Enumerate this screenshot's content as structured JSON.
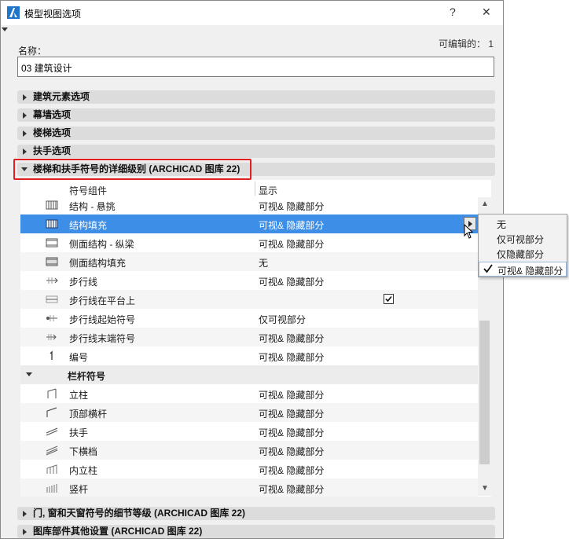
{
  "window": {
    "title": "模型视图选项",
    "help": "?",
    "close": "✕"
  },
  "form": {
    "name_label": "名称：",
    "editable_label": "可编辑的： 1",
    "name_value": "03 建筑设计"
  },
  "sections_top": [
    {
      "label": "建筑元素选项"
    },
    {
      "label": "幕墙选项"
    },
    {
      "label": "楼梯选项"
    },
    {
      "label": "扶手选项"
    },
    {
      "label": "楼梯和扶手符号的详细级别 (ARCHICAD 图库 22)"
    }
  ],
  "table": {
    "col_component": "符号组件",
    "col_display": "显示",
    "rows": [
      {
        "name": "结构 - 悬挑",
        "value": "可视& 隐藏部分",
        "icon": "stair-structure-icon"
      },
      {
        "name": "结构填充",
        "value": "可视& 隐藏部分",
        "icon": "stair-structure-fill-icon"
      },
      {
        "name": "侧面结构 - 纵梁",
        "value": "可视& 隐藏部分",
        "icon": "stringer-icon"
      },
      {
        "name": "侧面结构填充",
        "value": "无",
        "icon": "stringer-fill-icon"
      },
      {
        "name": "步行线",
        "value": "可视& 隐藏部分",
        "icon": "walking-line-icon"
      },
      {
        "name": "步行线在平台上",
        "value": "",
        "icon": "walking-line-landing-icon",
        "checked": true
      },
      {
        "name": "步行线起始符号",
        "value": "仅可视部分",
        "icon": "walking-line-start-icon"
      },
      {
        "name": "步行线末端符号",
        "value": "可视& 隐藏部分",
        "icon": "walking-line-end-icon"
      },
      {
        "name": "编号",
        "value": "可视& 隐藏部分",
        "icon": "numbering-icon"
      }
    ],
    "group_label": "栏杆符号",
    "rail_rows": [
      {
        "name": "立柱",
        "value": "可视& 隐藏部分",
        "icon": "post-icon"
      },
      {
        "name": "顶部横杆",
        "value": "可视& 隐藏部分",
        "icon": "top-rail-icon"
      },
      {
        "name": "扶手",
        "value": "可视& 隐藏部分",
        "icon": "handrail-icon"
      },
      {
        "name": "下横档",
        "value": "可视& 隐藏部分",
        "icon": "bottom-rail-icon"
      },
      {
        "name": "内立柱",
        "value": "可视& 隐藏部分",
        "icon": "inner-post-icon"
      },
      {
        "name": "竖杆",
        "value": "可视& 隐藏部分",
        "icon": "baluster-icon"
      }
    ]
  },
  "dropdown_menu": {
    "items": [
      "无",
      "仅可视部分",
      "仅隐藏部分",
      "可视& 隐藏部分"
    ],
    "selected": "可视& 隐藏部分"
  },
  "sections_bottom": [
    {
      "label": "门, 窗和天窗符号的细节等级 (ARCHICAD 图库 22)"
    },
    {
      "label": "图库部件其他设置 (ARCHICAD 图库 22)"
    }
  ],
  "colors": {
    "selection": "#3d8ee6",
    "highlight_border": "#e02020"
  }
}
